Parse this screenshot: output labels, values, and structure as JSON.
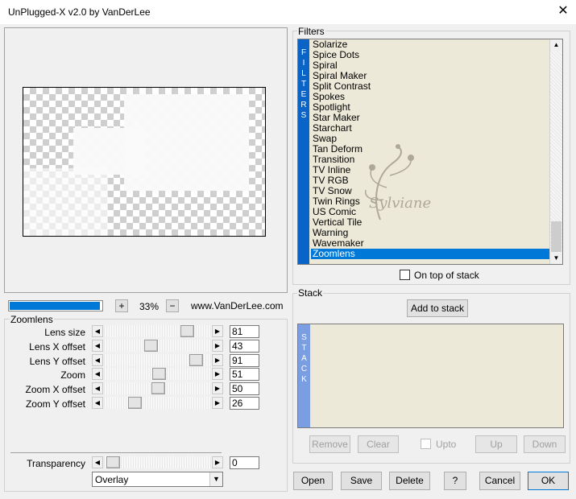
{
  "window": {
    "title": "UnPlugged-X v2.0 by VanDerLee",
    "close_glyph": "✕"
  },
  "preview": {
    "zoom_minus": "−",
    "zoom_plus": "+",
    "zoom_level": "33%",
    "progress": 0.98,
    "website": "www.VanDerLee.com"
  },
  "zoomlens": {
    "group_label": "Zoomlens",
    "params": [
      {
        "label": "Lens size",
        "value": "81"
      },
      {
        "label": "Lens X offset",
        "value": "43"
      },
      {
        "label": "Lens Y offset",
        "value": "91"
      },
      {
        "label": "Zoom",
        "value": "51"
      },
      {
        "label": "Zoom X offset",
        "value": "50"
      },
      {
        "label": "Zoom Y offset",
        "value": "26"
      }
    ],
    "transparency": {
      "label": "Transparency",
      "value": "0"
    },
    "blend_mode": "Overlay"
  },
  "filters": {
    "group_label": "Filters",
    "side_letters": [
      "F",
      "I",
      "L",
      "T",
      "E",
      "R",
      "S"
    ],
    "items": [
      "Solarize",
      "Spice Dots",
      "Spiral",
      "Spiral Maker",
      "Split Contrast",
      "Spokes",
      "Spotlight",
      "Star Maker",
      "Starchart",
      "Swap",
      "Tan Deform",
      "Transition",
      "TV Inline",
      "TV RGB",
      "TV Snow",
      "Twin Rings",
      "US Comic",
      "Vertical Tile",
      "Warning",
      "Wavemaker",
      "Zoomlens"
    ],
    "selected_index": 20,
    "on_top_label": "On top of stack",
    "watermark": "Sylviane"
  },
  "stack": {
    "group_label": "Stack",
    "add_label": "Add to stack",
    "side_letters": [
      "S",
      "T",
      "A",
      "C",
      "K"
    ],
    "remove_label": "Remove",
    "clear_label": "Clear",
    "upto_label": "Upto",
    "up_label": "Up",
    "down_label": "Down"
  },
  "footer": {
    "open": "Open",
    "save": "Save",
    "delete": "Delete",
    "help": "?",
    "cancel": "Cancel",
    "ok": "OK"
  },
  "icons": {
    "left_arrow": "◀",
    "right_arrow": "▶",
    "up_arrow": "▲",
    "down_arrow": "▼"
  },
  "colors": {
    "accent": "#0078d7",
    "filter_bar": "#0a64c8",
    "stack_bar": "#7b9ee2",
    "list_bg": "#ece9d8"
  }
}
